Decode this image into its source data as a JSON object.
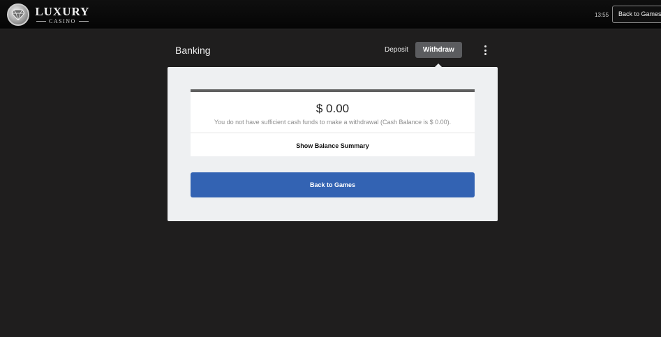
{
  "header": {
    "logo": {
      "main": "LUXURY",
      "sub": "CASINO",
      "icon": "diamond-emblem-icon"
    },
    "clock": "13:55",
    "back_button": "Back to Games"
  },
  "banking": {
    "title": "Banking",
    "tabs": [
      {
        "label": "Deposit",
        "active": false
      },
      {
        "label": "Withdraw",
        "active": true
      }
    ],
    "menu_icon": "vertical-dots-icon"
  },
  "withdraw": {
    "amount": "$ 0.00",
    "message": "You do not have sufficient cash funds to make a withdrawal (Cash Balance is $ 0.00).",
    "summary_link": "Show Balance Summary",
    "back_button": "Back to Games"
  },
  "colors": {
    "background": "#1f1e1e",
    "panel": "#eef0f2",
    "primary": "#3363b3",
    "active_tab": "#5b5c5f"
  }
}
